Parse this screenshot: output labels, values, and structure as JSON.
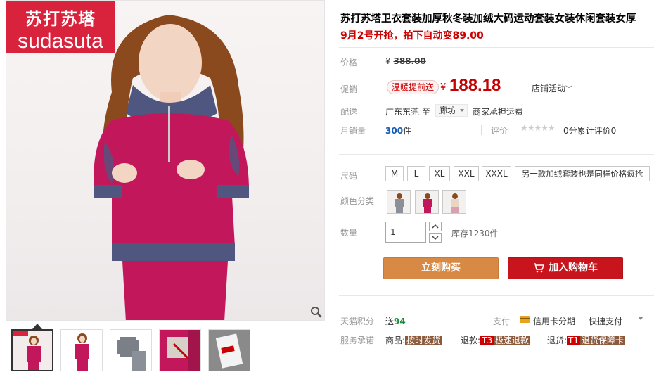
{
  "brand": {
    "logo_cn": "苏打苏塔",
    "logo_en": "sudasuta"
  },
  "product": {
    "title": "苏打苏塔卫衣套装加厚秋冬装加绒大码运动套装女装休闲套装女厚",
    "subtitle": "9月2号开抢，拍下自动变89.00"
  },
  "price": {
    "label": "价格",
    "currency": "¥",
    "original": "388.00",
    "promo_label": "促销",
    "promo_tag": "温暖提前送",
    "promo_currency": "¥",
    "promo_price": "188.18",
    "store_activity": "店铺活动"
  },
  "shipping": {
    "label": "配送",
    "from": "广东东莞 至",
    "to": "廊坊",
    "note": "商家承担运费"
  },
  "sales": {
    "label": "月销量",
    "count": "300",
    "unit": "件",
    "review_label": "评价",
    "stars": "★★★★★",
    "review_text": "0分累计评价0"
  },
  "sku": {
    "size_label": "尺码",
    "sizes": [
      "M",
      "L",
      "XL",
      "XXL",
      "XXXL",
      "另一款加绒套装也是同样价格疯抢"
    ],
    "color_label": "颜色分类",
    "colors": [
      "gray",
      "rose",
      "pink"
    ],
    "qty_label": "数量",
    "qty_value": "1",
    "stock": "库存1230件"
  },
  "actions": {
    "buy": "立刻购买",
    "cart": "加入购物车"
  },
  "points": {
    "label": "天猫积分",
    "prefix": "送",
    "value": "94"
  },
  "payment": {
    "label": "支付",
    "credit": "信用卡分期",
    "quick": "快捷支付"
  },
  "service": {
    "label": "服务承诺",
    "item1_prefix": "商品:",
    "item1_tag": "按时发货",
    "item2_prefix": "退款:",
    "item2_tag_a": "T3",
    "item2_tag_b": "极速退款",
    "item3_prefix": "退货:",
    "item3_tag_a": "T1",
    "item3_tag_b": "退货保障卡"
  },
  "colors_theme": {
    "price_red": "#c40000",
    "buy_orange": "#d88a45",
    "cart_red": "#c8141c",
    "sweater_magenta": "#c2185b"
  }
}
